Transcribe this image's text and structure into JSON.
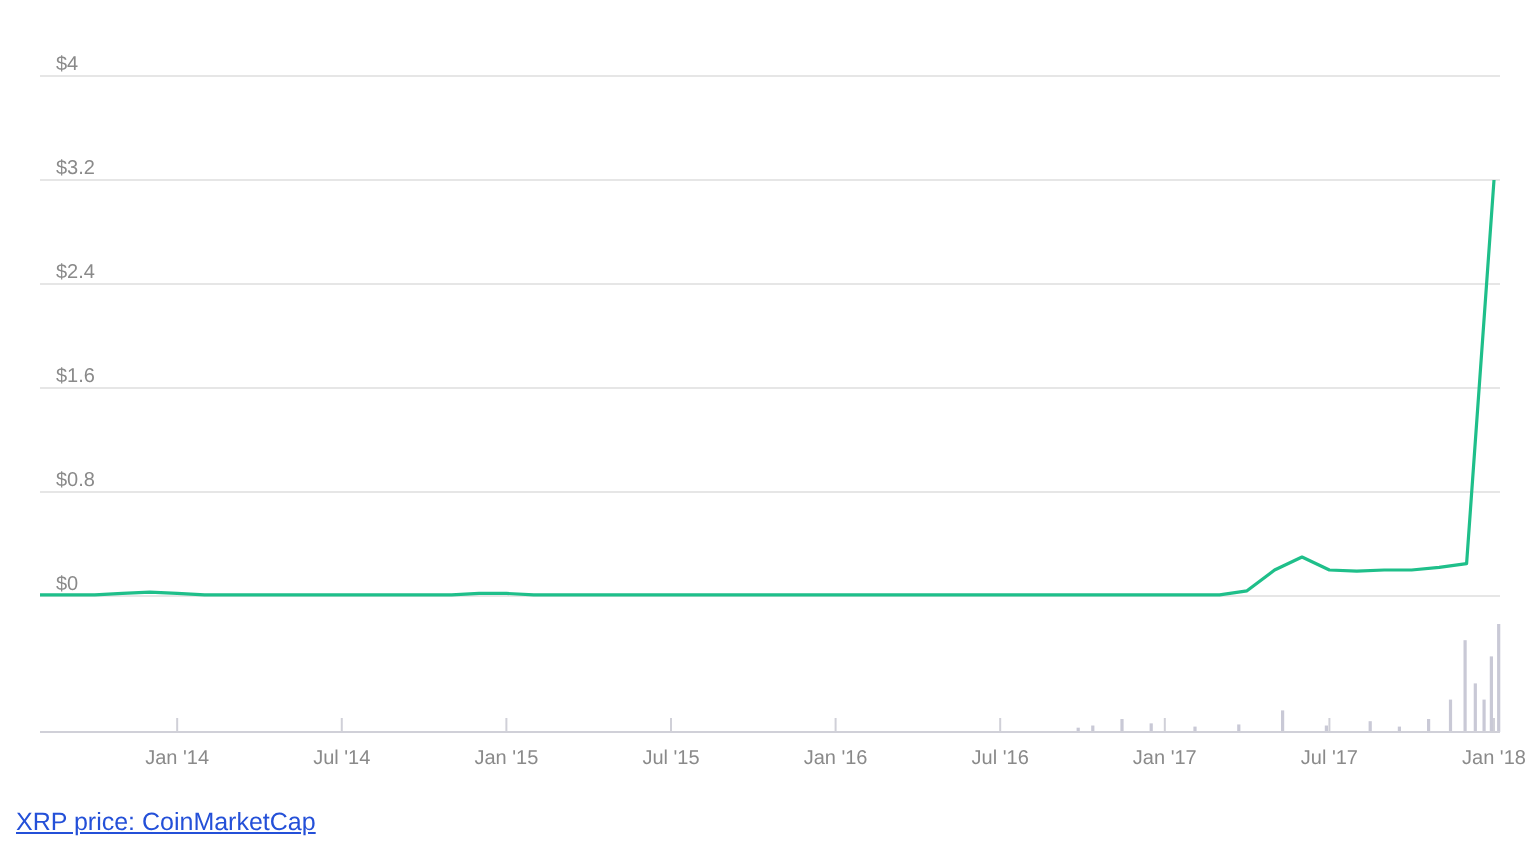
{
  "chart": {
    "chart_data": {
      "type": "line",
      "categories": [
        null,
        null,
        null,
        null,
        null,
        "Jan '14",
        null,
        null,
        null,
        null,
        null,
        "Jul '14",
        null,
        null,
        null,
        null,
        null,
        "Jan '15",
        null,
        null,
        null,
        null,
        null,
        "Jul '15",
        null,
        null,
        null,
        null,
        null,
        "Jan '16",
        null,
        null,
        null,
        null,
        null,
        "Jul '16",
        null,
        null,
        null,
        null,
        null,
        "Jan '17",
        null,
        null,
        null,
        null,
        null,
        "Jul '17",
        null,
        null,
        null,
        null,
        null,
        "Jan '18"
      ],
      "series": [
        {
          "color": "#1fbf8a",
          "values": [
            0.01,
            0.01,
            0.01,
            0.02,
            0.03,
            0.02,
            0.01,
            0.01,
            0.01,
            0.01,
            0.01,
            0.01,
            0.01,
            0.01,
            0.01,
            0.01,
            0.02,
            0.02,
            0.01,
            0.01,
            0.01,
            0.01,
            0.01,
            0.01,
            0.01,
            0.01,
            0.01,
            0.01,
            0.01,
            0.01,
            0.01,
            0.01,
            0.01,
            0.01,
            0.01,
            0.01,
            0.01,
            0.01,
            0.01,
            0.01,
            0.01,
            0.01,
            0.01,
            0.01,
            0.04,
            0.2,
            0.3,
            0.2,
            0.19,
            0.2,
            0.2,
            0.22,
            0.25,
            3.2
          ]
        }
      ],
      "ylim": [
        0,
        4
      ],
      "grid": true,
      "yticks": [
        {
          "value": 0,
          "label": "$0"
        },
        {
          "value": 0.8,
          "label": "$0.8"
        },
        {
          "value": 1.6,
          "label": "$1.6"
        },
        {
          "value": 2.4,
          "label": "$2.4"
        },
        {
          "value": 3.2,
          "label": "$3.2"
        },
        {
          "value": 4,
          "label": "$4"
        }
      ]
    }
  },
  "source_link": {
    "text": "XRP price: CoinMarketCap"
  }
}
